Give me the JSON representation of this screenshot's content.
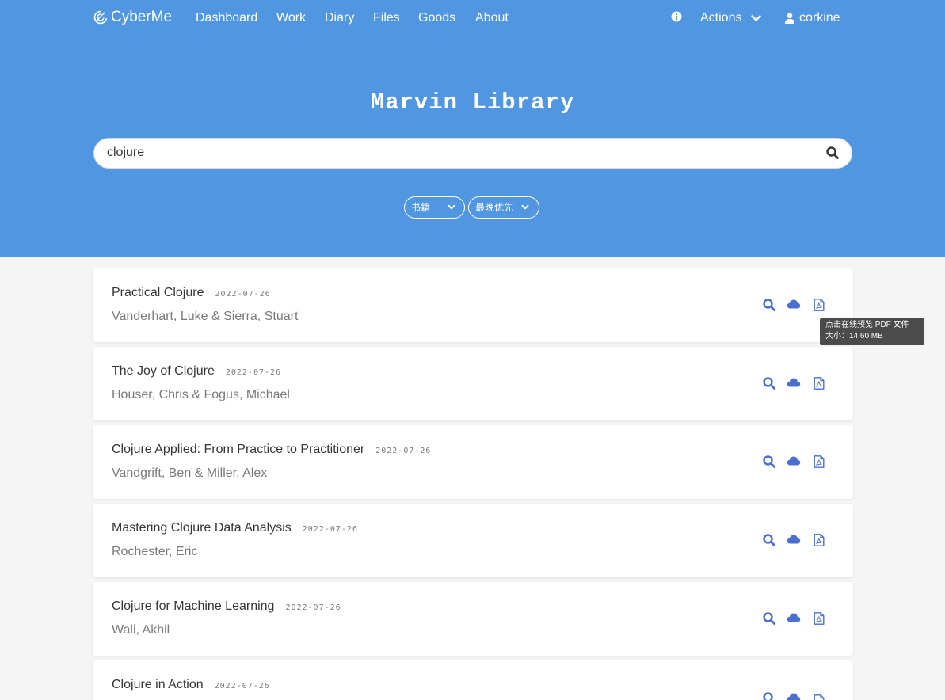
{
  "nav": {
    "brand": "CyberMe",
    "links": [
      "Dashboard",
      "Work",
      "Diary",
      "Files",
      "Goods",
      "About"
    ],
    "actions_label": "Actions",
    "user": "corkine"
  },
  "hero": {
    "title": "Marvin Library",
    "search_value": "clojure",
    "filters": {
      "type": "书籍",
      "sort": "最晚优先"
    }
  },
  "books": [
    {
      "title": "Practical Clojure",
      "date": "2022-07-26",
      "authors": "Vanderhart, Luke & Sierra, Stuart"
    },
    {
      "title": "The Joy of Clojure",
      "date": "2022-07-26",
      "authors": "Houser, Chris & Fogus, Michael"
    },
    {
      "title": "Clojure Applied: From Practice to Practitioner",
      "date": "2022-07-26",
      "authors": "Vandgrift, Ben & Miller, Alex"
    },
    {
      "title": "Mastering Clojure Data Analysis",
      "date": "2022-07-26",
      "authors": "Rochester, Eric"
    },
    {
      "title": "Clojure for Machine Learning",
      "date": "2022-07-26",
      "authors": "Wali, Akhil"
    },
    {
      "title": "Clojure in Action",
      "date": "2022-07-26",
      "authors": ""
    }
  ],
  "tooltip": {
    "line1": "点击在线预览 PDF 文件",
    "line2": "大小：14.60 MB"
  },
  "colors": {
    "hero": "#5096e1",
    "icon": "#4a6fd1",
    "text": "#363636",
    "muted": "#7a7a7a"
  },
  "icons": [
    "logo-icon",
    "info-icon",
    "chevron-down-icon",
    "user-icon",
    "search-icon",
    "cloud-icon",
    "pdf-icon"
  ]
}
